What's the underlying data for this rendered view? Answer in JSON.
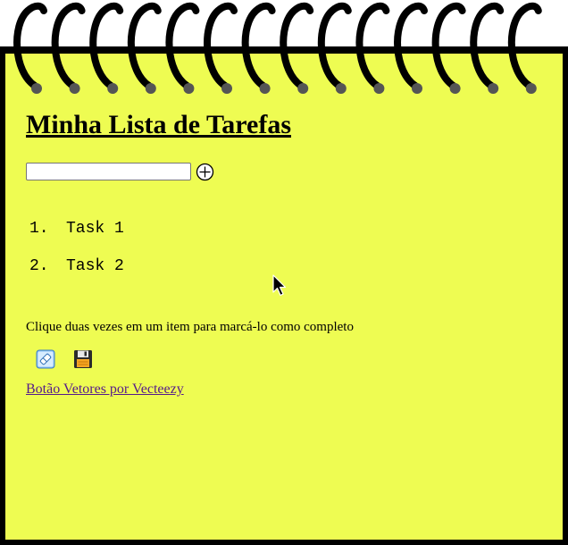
{
  "page": {
    "title": "Minha Lista de Tarefas",
    "colors": {
      "paper": "#eefc52",
      "border": "#000000",
      "link": "#551a8b"
    }
  },
  "add_task": {
    "input_value": "",
    "button_icon": "plus-circle-icon"
  },
  "tasks": [
    {
      "number": "1.",
      "label": "Task 1"
    },
    {
      "number": "2.",
      "label": "Task 2"
    }
  ],
  "hint_text": "Clique duas vezes em um item para marcá-lo como completo",
  "toolbar": {
    "clear_icon": "eraser-icon",
    "save_icon": "floppy-disk-icon"
  },
  "credit_link": "Botão Vetores por Vecteezy"
}
